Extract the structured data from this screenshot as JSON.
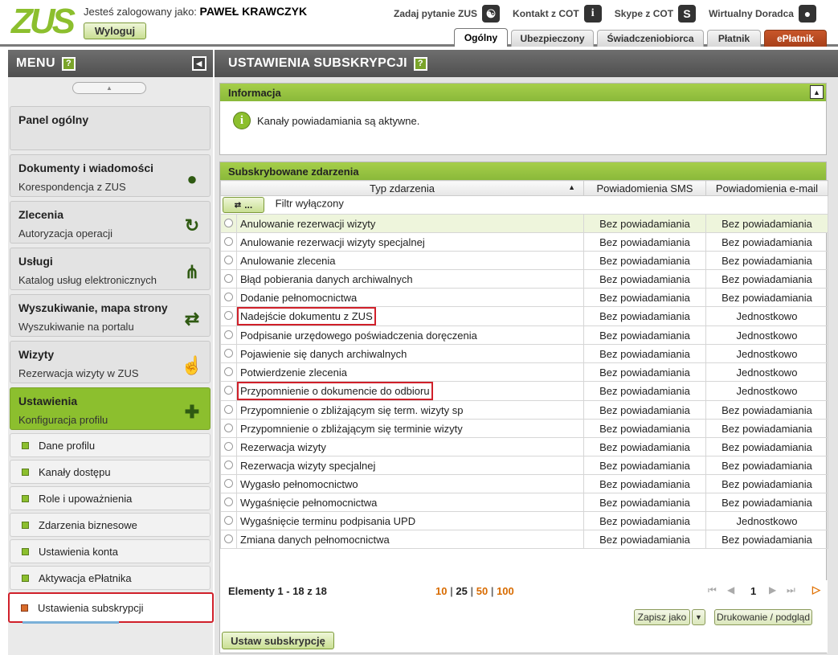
{
  "header": {
    "logo_text": "ZUS",
    "logged_as_label": "Jesteś zalogowany jako:",
    "user_name": "PAWEŁ KRAWCZYK",
    "logout_label": "Wyloguj",
    "links": [
      {
        "label": "Zadaj pytanie ZUS",
        "icon": "question-bubble-icon"
      },
      {
        "label": "Kontakt z COT",
        "icon": "info-icon"
      },
      {
        "label": "Skype z COT",
        "icon": "skype-icon"
      },
      {
        "label": "Wirtualny Doradca",
        "icon": "person-icon"
      }
    ],
    "tabs": [
      {
        "label": "Ogólny",
        "active": true
      },
      {
        "label": "Ubezpieczony"
      },
      {
        "label": "Świadczeniobiorca"
      },
      {
        "label": "Płatnik"
      },
      {
        "label": "ePłatnik"
      }
    ]
  },
  "sidebar": {
    "title": "MENU",
    "help": "?",
    "items": [
      {
        "title": "Panel ogólny",
        "subtitle": ""
      },
      {
        "title": "Dokumenty i wiadomości",
        "subtitle": "Korespondencja z ZUS",
        "icon": "speech-bubble-icon"
      },
      {
        "title": "Zlecenia",
        "subtitle": "Autoryzacja operacji",
        "icon": "refresh-icon"
      },
      {
        "title": "Usługi",
        "subtitle": "Katalog usług elektronicznych",
        "icon": "fork-icon"
      },
      {
        "title": "Wyszukiwanie, mapa strony",
        "subtitle": "Wyszukiwanie na portalu",
        "icon": "sync-icon"
      },
      {
        "title": "Wizyty",
        "subtitle": "Rezerwacja wizyty w ZUS",
        "icon": "walking-person-icon"
      },
      {
        "title": "Ustawienia",
        "subtitle": "Konfiguracja profilu",
        "icon": "puzzle-icon"
      }
    ],
    "subitems": [
      "Dane profilu",
      "Kanały dostępu",
      "Role i upoważnienia",
      "Zdarzenia biznesowe",
      "Ustawienia konta",
      "Aktywacja ePłatnika",
      "Ustawienia subskrypcji"
    ]
  },
  "page": {
    "title": "USTAWIENIA SUBSKRYPCJI",
    "help": "?",
    "info_panel": {
      "title": "Informacja",
      "message": "Kanały powiadamiania są aktywne."
    },
    "events_panel": {
      "title": "Subskrybowane zdarzenia",
      "columns": [
        "Typ zdarzenia",
        "Powiadomienia SMS",
        "Powiadomienia e-mail"
      ],
      "filter_button": "...",
      "filter_label": "Filtr wyłączony",
      "rows": [
        {
          "name": "Anulowanie rezerwacji wizyty",
          "sms": "Bez powiadamiania",
          "email": "Bez powiadamiania"
        },
        {
          "name": "Anulowanie rezerwacji wizyty specjalnej",
          "sms": "Bez powiadamiania",
          "email": "Bez powiadamiania"
        },
        {
          "name": "Anulowanie zlecenia",
          "sms": "Bez powiadamiania",
          "email": "Bez powiadamiania"
        },
        {
          "name": "Błąd pobierania danych archiwalnych",
          "sms": "Bez powiadamiania",
          "email": "Bez powiadamiania"
        },
        {
          "name": "Dodanie pełnomocnictwa",
          "sms": "Bez powiadamiania",
          "email": "Bez powiadamiania"
        },
        {
          "name": "Nadejście dokumentu z ZUS",
          "sms": "Bez powiadamiania",
          "email": "Jednostkowo"
        },
        {
          "name": "Podpisanie urzędowego poświadczenia doręczenia",
          "sms": "Bez powiadamiania",
          "email": "Jednostkowo"
        },
        {
          "name": "Pojawienie się danych archiwalnych",
          "sms": "Bez powiadamiania",
          "email": "Jednostkowo"
        },
        {
          "name": "Potwierdzenie zlecenia",
          "sms": "Bez powiadamiania",
          "email": "Jednostkowo"
        },
        {
          "name": "Przypomnienie o dokumencie do odbioru",
          "sms": "Bez powiadamiania",
          "email": "Jednostkowo"
        },
        {
          "name": "Przypomnienie o zbliżającym się term. wizyty sp",
          "sms": "Bez powiadamiania",
          "email": "Bez powiadamiania"
        },
        {
          "name": "Przypomnienie o zbliżającym się terminie wizyty",
          "sms": "Bez powiadamiania",
          "email": "Bez powiadamiania"
        },
        {
          "name": "Rezerwacja wizyty",
          "sms": "Bez powiadamiania",
          "email": "Bez powiadamiania"
        },
        {
          "name": "Rezerwacja wizyty specjalnej",
          "sms": "Bez powiadamiania",
          "email": "Bez powiadamiania"
        },
        {
          "name": "Wygasło pełnomocnictwo",
          "sms": "Bez powiadamiania",
          "email": "Bez powiadamiania"
        },
        {
          "name": "Wygaśnięcie pełnomocnictwa",
          "sms": "Bez powiadamiania",
          "email": "Bez powiadamiania"
        },
        {
          "name": "Wygaśnięcie terminu podpisania UPD",
          "sms": "Bez powiadamiania",
          "email": "Jednostkowo"
        },
        {
          "name": "Zmiana danych pełnomocnictwa",
          "sms": "Bez powiadamiania",
          "email": "Bez powiadamiania"
        }
      ],
      "footer": {
        "elements_label": "Elementy 1 - 18 z 18",
        "page_sizes": [
          "10",
          "25",
          "50",
          "100"
        ],
        "current_page": "1",
        "save_as": "Zapisz jako",
        "print": "Drukowanie / podgląd"
      },
      "submit": "Ustaw subskrypcję"
    }
  },
  "colors": {
    "accent_green": "#8cbf2e",
    "header_gray": "#5a5a5a",
    "highlight_red": "#d0202a",
    "epłatnik_tab": "#b84a20",
    "page_size_orange": "#d86b00"
  }
}
